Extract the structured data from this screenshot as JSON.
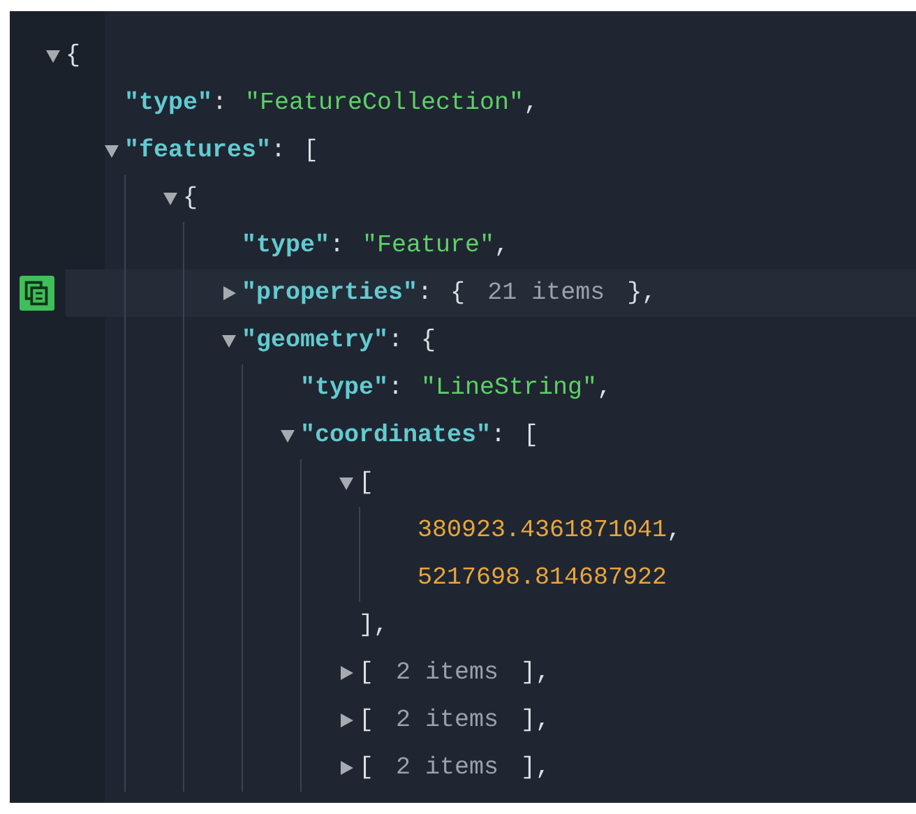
{
  "tree": {
    "kind": "branch",
    "expanded": true,
    "open": "{",
    "children": [
      {
        "kind": "string",
        "key": "\"type\"",
        "sep": ":",
        "value": "\"FeatureCollection\"",
        "tail": ","
      },
      {
        "kind": "branch",
        "key": "\"features\"",
        "sep": ":",
        "expanded": true,
        "open": "[",
        "children": [
          {
            "kind": "branch",
            "expanded": true,
            "open": "{",
            "children": [
              {
                "kind": "string",
                "key": "\"type\"",
                "sep": ":",
                "value": "\"Feature\"",
                "tail": ",",
                "hovered": false
              },
              {
                "kind": "branch",
                "key": "\"properties\"",
                "sep": ":",
                "expanded": false,
                "hovered": true,
                "open": "{",
                "summary": "21 items",
                "close": "},"
              },
              {
                "kind": "branch",
                "key": "\"geometry\"",
                "sep": ":",
                "expanded": true,
                "hovered": false,
                "open": "{",
                "children": [
                  {
                    "kind": "string",
                    "key": "\"type\"",
                    "sep": ":",
                    "value": "\"LineString\"",
                    "tail": ","
                  },
                  {
                    "kind": "branch",
                    "key": "\"coordinates\"",
                    "sep": ":",
                    "expanded": true,
                    "open": "[",
                    "children": [
                      {
                        "kind": "branch",
                        "expanded": true,
                        "open": "[",
                        "children": [
                          {
                            "kind": "number",
                            "value": "380923.4361871041",
                            "tail": ","
                          },
                          {
                            "kind": "number",
                            "value": "5217698.814687922"
                          }
                        ],
                        "close": "],"
                      },
                      {
                        "kind": "branch",
                        "expanded": false,
                        "open": "[",
                        "summary": "2 items",
                        "close": "],"
                      },
                      {
                        "kind": "branch",
                        "expanded": false,
                        "open": "[",
                        "summary": "2 items",
                        "close": "],"
                      },
                      {
                        "kind": "branch",
                        "expanded": false,
                        "open": "[",
                        "summary": "2 items",
                        "close": "],"
                      }
                    ]
                  }
                ]
              }
            ]
          }
        ]
      }
    ]
  }
}
